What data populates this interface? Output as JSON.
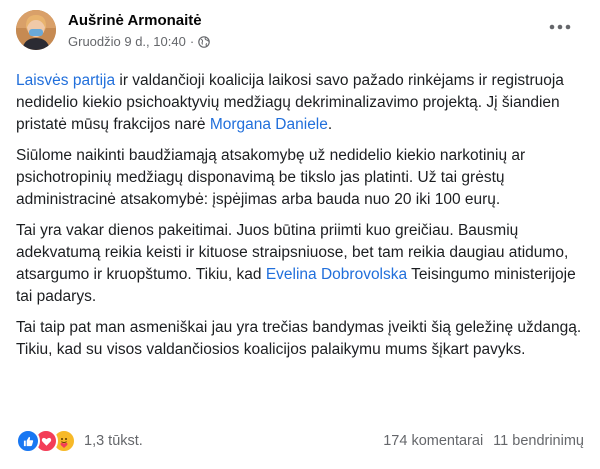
{
  "post": {
    "author": "Aušrinė Armonaitė",
    "timestamp": "Gruodžio 9 d., 10:40",
    "separator": "·",
    "privacy_icon": "globe-icon",
    "more_icon": "more-options-icon",
    "paragraphs": [
      [
        {
          "type": "link",
          "text": "Laisvės partija"
        },
        {
          "type": "text",
          "text": " ir valdančioji koalicija laikosi savo pažado rinkėjams ir registruoja nedidelio kiekio psichoaktyvių medžiagų dekriminalizavimo projektą. Jį šiandien pristatė mūsų frakcijos narė "
        },
        {
          "type": "link",
          "text": "Morgana Daniele"
        },
        {
          "type": "text",
          "text": "."
        }
      ],
      [
        {
          "type": "text",
          "text": "Siūlome naikinti baudžiamąją atsakomybę už nedidelio kiekio narkotinių ar psichotropinių medžiagų disponavimą be tikslo jas platinti. Už tai grėstų administracinė atsakomybė: įspėjimas arba bauda nuo 20 iki 100 eurų."
        }
      ],
      [
        {
          "type": "text",
          "text": "Tai yra vakar dienos pakeitimai. Juos būtina priimti kuo greičiau. Bausmių adekvatumą reikia keisti ir kituose straipsniuose, bet tam reikia daugiau atidumo, atsargumo ir kruopštumo. Tikiu, kad "
        },
        {
          "type": "link",
          "text": "Evelina Dobrovolska"
        },
        {
          "type": "text",
          "text": " Teisingumo ministerijoje tai padarys."
        }
      ],
      [
        {
          "type": "text",
          "text": "Tai taip pat man asmeniškai jau yra trečias bandymas įveikti šią geležinę uždangą. Tikiu, kad su visos valdančiosios koalicijos palaikymu mums šįkart pavyks."
        }
      ]
    ]
  },
  "footer": {
    "reaction_icons": [
      "like-reaction-icon",
      "love-reaction-icon",
      "care-reaction-icon"
    ],
    "reaction_count": "1,3 tūkst.",
    "comments": "174 komentarai",
    "shares": "11 bendrinimų"
  },
  "colors": {
    "link": "#216fdb",
    "muted": "#65676b",
    "like": "#1877f2",
    "love": "#f33e58",
    "care": "#f7b928"
  }
}
